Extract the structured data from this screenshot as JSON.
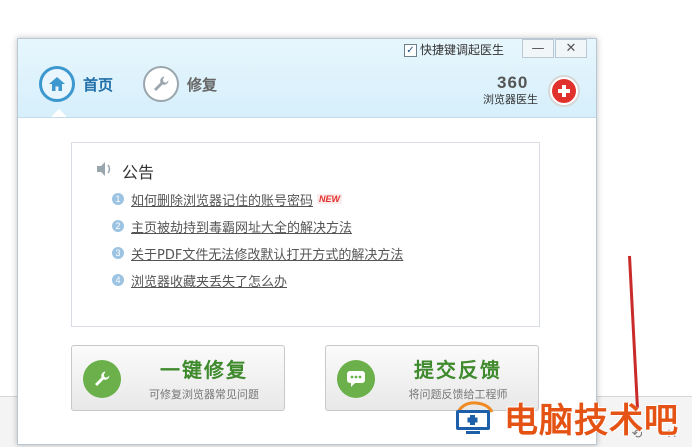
{
  "window": {
    "quick_key_label": "快捷键调起医生",
    "minimize": "—",
    "close": "✕"
  },
  "tabs": [
    {
      "label": "首页",
      "icon": "home-icon",
      "active": true
    },
    {
      "label": "修复",
      "icon": "wrench-icon",
      "active": false
    }
  ],
  "brand": {
    "number": "360",
    "name": "浏览器医生",
    "color": "#e0312c"
  },
  "notice": {
    "title": "公告",
    "items": [
      {
        "num": "1",
        "text": "如何删除浏览器记住的账号密码",
        "badge": "NEW"
      },
      {
        "num": "2",
        "text": "主页被劫持到毒霸网址大全的解决方法"
      },
      {
        "num": "3",
        "text": "关于PDF文件无法修改默认打开方式的解决方法"
      },
      {
        "num": "4",
        "text": "浏览器收藏夹丢失了怎么办"
      }
    ]
  },
  "actions": [
    {
      "title": "一键修复",
      "sub": "可修复浏览器常见问题",
      "icon": "wrench-icon"
    },
    {
      "title": "提交反馈",
      "sub": "将问题反馈给工程师",
      "icon": "chat-icon"
    }
  ],
  "watermark": {
    "text": "电脑技术吧"
  },
  "colors": {
    "accent": "#3d98cf",
    "green": "#6bb04a",
    "header_bg": "#d6effb"
  }
}
